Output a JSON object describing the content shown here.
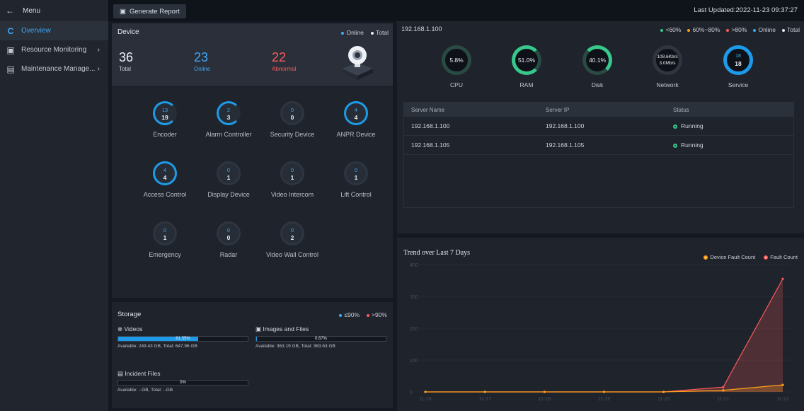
{
  "sidebar": {
    "menu_label": "Menu",
    "items": [
      {
        "label": "Overview",
        "active": true
      },
      {
        "label": "Resource Monitoring",
        "active": false
      },
      {
        "label": "Maintenance Manage...",
        "active": false
      }
    ]
  },
  "topbar": {
    "generate_report_label": "Generate Report",
    "last_updated": "Last Updated:2022-11-23 09:37:27"
  },
  "device": {
    "title": "Device",
    "legend": {
      "online": "Online",
      "total": "Total"
    },
    "total_num": "36",
    "total_label": "Total",
    "online_num": "23",
    "online_label": "Online",
    "abnormal_num": "22",
    "abnormal_label": "Abnormal",
    "types": [
      {
        "name": "Encoder",
        "online": "13",
        "total": "19",
        "highlight": true
      },
      {
        "name": "Alarm Controller",
        "online": "2",
        "total": "3",
        "highlight": true
      },
      {
        "name": "Security Device",
        "online": "0",
        "total": "0",
        "highlight": false
      },
      {
        "name": "ANPR Device",
        "online": "4",
        "total": "4",
        "highlight": true
      },
      {
        "name": "Access Control",
        "online": "4",
        "total": "4",
        "highlight": true
      },
      {
        "name": "Display Device",
        "online": "0",
        "total": "1",
        "highlight": false
      },
      {
        "name": "Video Intercom",
        "online": "0",
        "total": "1",
        "highlight": false
      },
      {
        "name": "Lift Control",
        "online": "0",
        "total": "1",
        "highlight": false
      },
      {
        "name": "Emergency",
        "online": "0",
        "total": "1",
        "highlight": false
      },
      {
        "name": "Radar",
        "online": "0",
        "total": "0",
        "highlight": false
      },
      {
        "name": "Video Wall Control",
        "online": "0",
        "total": "2",
        "highlight": false
      }
    ]
  },
  "storage": {
    "title": "Storage",
    "legend": {
      "low": "≤90%",
      "high": ">90%"
    },
    "videos": {
      "label": "Videos",
      "pct": "61.55%",
      "fill": 0.6155,
      "avail": "Available: 249.43 GB, Total: 647.96 GB"
    },
    "images": {
      "label": "Images and Files",
      "pct": "0.67%",
      "fill": 0.0067,
      "avail": "Available: 363.19 GB, Total: 363.63 GB"
    },
    "incident": {
      "label": "Incident Files",
      "pct": "0%",
      "fill": 0,
      "avail": "Available: --GB, Total: --GB"
    }
  },
  "server": {
    "ip": "192.168.1.100",
    "legend": {
      "lt60": "<60%",
      "mid": "60%~80%",
      "gt80": ">80%",
      "online": "Online",
      "total": "Total"
    },
    "gauges": {
      "cpu": {
        "label": "CPU",
        "value": "5.8%"
      },
      "ram": {
        "label": "RAM",
        "value": "51.0%"
      },
      "disk": {
        "label": "Disk",
        "value": "40.1%"
      },
      "network": {
        "label": "Network",
        "up": "108.6Kb/s",
        "down": "3.0Mb/s"
      },
      "service": {
        "label": "Service",
        "online": "18",
        "total": "18"
      }
    },
    "table": {
      "headers": [
        "Server Name",
        "Server IP",
        "Status"
      ],
      "rows": [
        {
          "name": "192.168.1.100",
          "ip": "192.168.1.100",
          "status": "Running"
        },
        {
          "name": "192.168.1.105",
          "ip": "192.168.1.105",
          "status": "Running"
        }
      ]
    }
  },
  "trend": {
    "title": "Trend over Last 7 Days",
    "legend": {
      "device_fault": "Device Fault Count",
      "fault": "Fault Count"
    },
    "colors": {
      "device_fault": "#ff9f1a",
      "fault": "#ff5a5a"
    }
  },
  "chart_data": {
    "type": "line",
    "title": "Trend over Last 7 Days",
    "categories": [
      "11-16",
      "11-17",
      "11-18",
      "11-19",
      "11-20",
      "11-21",
      "11-22"
    ],
    "ylim": [
      0,
      400
    ],
    "yticks": [
      "0",
      "100",
      "200",
      "300",
      "400"
    ],
    "series": [
      {
        "name": "Device Fault Count",
        "values": [
          0,
          0,
          0,
          0,
          0,
          5,
          22
        ]
      },
      {
        "name": "Fault Count",
        "values": [
          0,
          0,
          0,
          0,
          0,
          15,
          355
        ]
      }
    ]
  }
}
